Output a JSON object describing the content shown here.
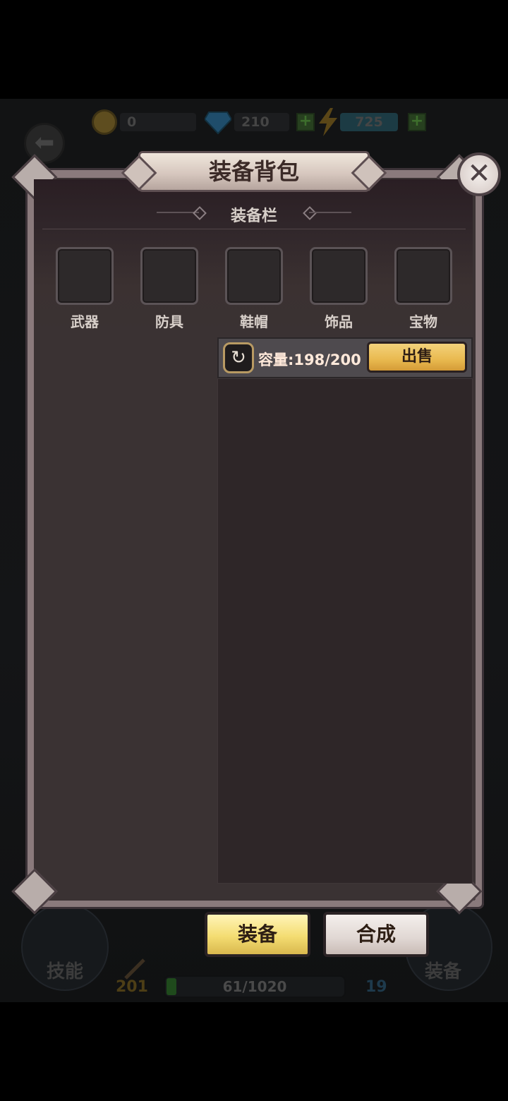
{
  "hud": {
    "coins": "0",
    "gems": "210",
    "energy": "725"
  },
  "bottom_hud": {
    "skill_label": "技能",
    "equip_label": "装备",
    "attack_value": "201",
    "exp_text": "61/1020",
    "defense_value": "19"
  },
  "dialog": {
    "title": "装备背包",
    "slot_section_title": "装备栏",
    "slots": [
      "武器",
      "防具",
      "鞋帽",
      "饰品",
      "宝物"
    ],
    "capacity_label": "容量:",
    "capacity_value": "198/200",
    "sell_label": "出售"
  },
  "tabs": {
    "equip": "装备",
    "synthesize": "合成"
  },
  "icons": {
    "close": "close-icon",
    "refresh": "refresh-icon",
    "back": "back-arrow-icon"
  },
  "colors": {
    "sell_button": "#e9b94f",
    "equip_tab": "#f4dd72",
    "synth_tab": "#e0d7d3",
    "frame": "#8a7a7c"
  }
}
